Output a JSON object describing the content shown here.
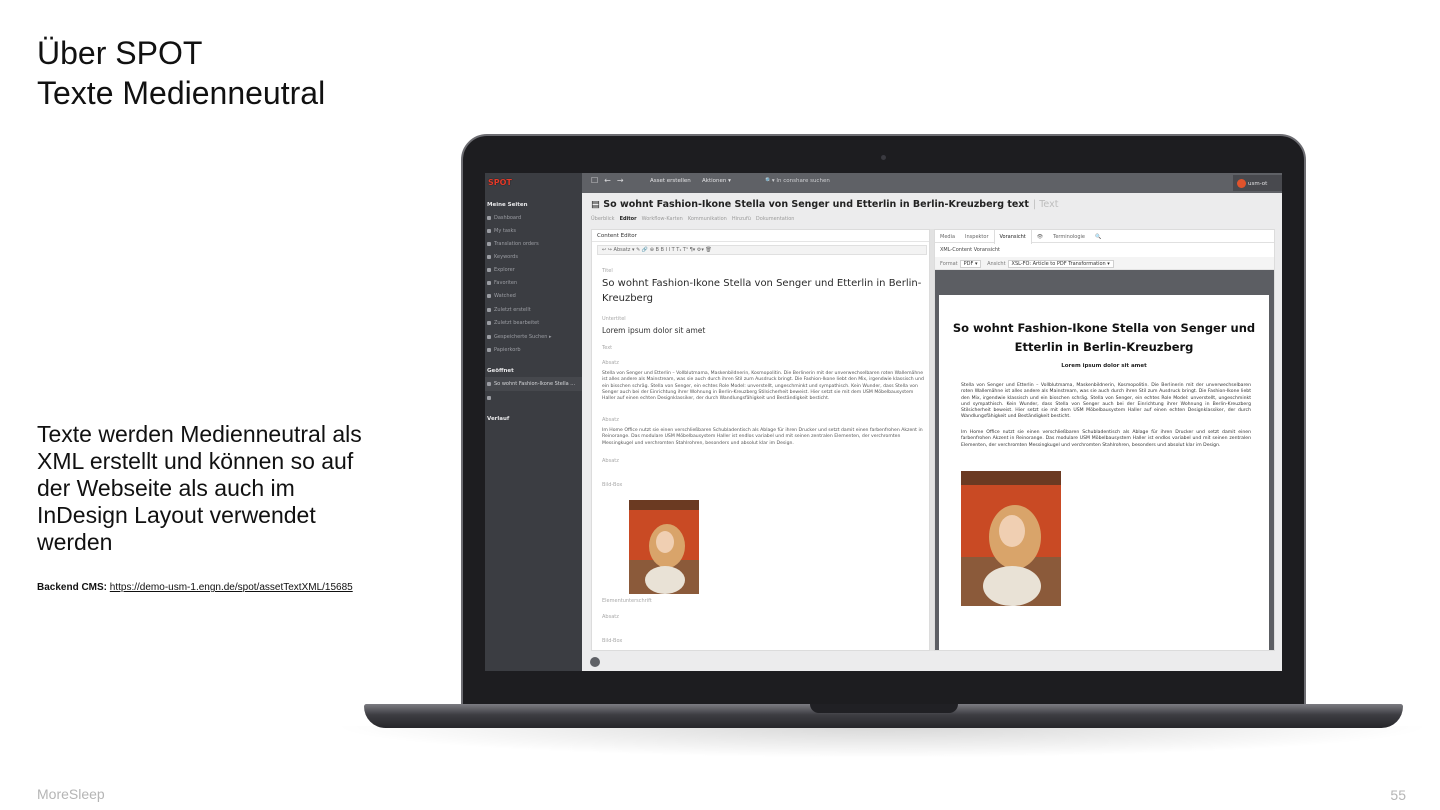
{
  "slide": {
    "title_line1": "Über SPOT",
    "title_line2": "Texte Medienneutral",
    "body": "Texte werden Medienneutral als XML erstellt und können so auf der Webseite als auch im InDesign Layout verwendet werden",
    "backend_label": "Backend CMS:",
    "backend_url": "https://demo-usm-1.engn.de/spot/assetTextXML/15685",
    "footer_brand": "MoreSleep",
    "page_number": "55"
  },
  "app": {
    "logo": "SPOT",
    "topbar": {
      "create_asset": "Asset erstellen",
      "actions": "Aktionen ▾",
      "search_placeholder": "In conshare suchen",
      "user": "usm-ot"
    },
    "sidebar": {
      "my_pages": "Meine Seiten",
      "items": [
        "Dashboard",
        "My tasks",
        "Translation orders",
        "Keywords",
        "Explorer",
        "Favoriten",
        "Watched",
        "Zuletzt erstellt",
        "Zuletzt bearbeitet",
        "Gespeicherte Suchen ▸",
        "Papierkorb"
      ],
      "opened_header": "Geöffnet",
      "opened_item": "So wohnt Fashion-Ikone Stella ...",
      "history_header": "Verlauf"
    },
    "document": {
      "title": "So wohnt Fashion-Ikone Stella von Senger und Etterlin in Berlin-Kreuzberg text",
      "type_suffix": "| Text",
      "subtabs": [
        "Überblick",
        "Editor",
        "Workflow-Karten",
        "Kommunikation",
        "Hinzufü",
        "Dokumentation"
      ]
    },
    "editor": {
      "header": "Content Editor",
      "toolbar": "↩ ↪  Absatz ▾   ✎ 🔗 ⊕   B  B  I  I  T  T₁ T¹  ¶▾  ⚙▾  🗑",
      "label_titel": "Titel",
      "titel": "So wohnt Fashion-Ikone Stella von Senger und Etterlin in Berlin-Kreuzberg",
      "label_untertitel": "Untertitel",
      "untertitel": "Lorem ipsum dolor sit amet",
      "label_text": "Text",
      "label_absatz": "Absatz",
      "absatz1": "Stella von Senger und Etterlin – Vollblutmama, Maskenbildnerin, Kosmopolitin. Die Berlinerin mit der unverwechselbaren roten Wallemähne ist alles andere als Mainstream, was sie auch durch ihren Stil zum Ausdruck bringt. Die Fashion-Ikone liebt den Mix, irgendwie klassisch und ein bisschen schräg. Stella von Senger, ein echtes Role Model: unverstellt, ungeschminkt und sympathisch. Kein Wunder, dass Stella von Senger auch bei der Einrichtung ihrer Wohnung in Berlin-Kreuzberg Stilsicherheit beweist. Hier setzt sie mit dem USM Möbelbausystem Haller auf einen echten Designklassiker, der durch Wandlungsfähigkeit und Beständigkeit besticht.",
      "absatz2": "Im Home Office nutzt sie einen verschließbaren Schubladentisch als Ablage für ihren Drucker und setzt damit einen farbenfrohen Akzent in Reinorange. Das modulare USM Möbelbausystem Haller ist endlos variabel und mit seinen zentralen Elementen, der verchromten Messingkugel und verchromten Stahlrohren, besonders und absolut klar im Design.",
      "label_absatz3": "Absatz",
      "label_bildbox": "Bild-Box",
      "label_unterschrift": "Elementunterschrift",
      "label_absatz4": "Absatz",
      "label_bildbox2": "Bild-Box"
    },
    "preview": {
      "tabs": [
        "Media",
        "Inspektor",
        "Voransicht",
        "👁",
        "Terminologie",
        "🔍"
      ],
      "sub": "XML-Content Voransicht",
      "format_label": "Format",
      "format_value": "PDF ▾",
      "view_label": "Ansicht",
      "view_value": "XSL-FO: Article to PDF Transformation ▾",
      "title": "So wohnt Fashion-Ikone Stella von Senger und Etterlin in Berlin-Kreuzberg",
      "subtitle": "Lorem ipsum dolor sit amet",
      "p1": "Stella von Senger und Etterlin – Vollblutmama, Maskenbildnerin, Kosmopolitin. Die Berlinerin mit der unverwechselbaren roten Wallemähne ist alles andere als Mainstream, was sie auch durch ihren Stil zum Ausdruck bringt. Die Fashion-Ikone liebt den Mix, irgendwie klassisch und ein bisschen schräg. Stella von Senger, ein echtes Role Model: unverstellt, ungeschminkt und sympathisch. Kein Wunder, dass Stella von Senger auch bei der Einrichtung ihrer Wohnung in Berlin-Kreuzberg Stilsicherheit beweist. Hier setzt sie mit dem USM Möbelbausystem Haller auf einen echten Designklassiker, der durch Wandlungsfähigkeit und Beständigkeit besticht.",
      "p2": "Im Home Office nutzt sie einen verschließbaren Schubladentisch als Ablage für ihren Drucker und setzt damit einen farbenfrohen Akzent in Reinorange. Das modulare USM Möbelbausystem Haller ist endlos variabel und mit seinen zentralen Elementen, der verchromten Messingkugel und verchromten Stahlrohren, besonders und absolut klar im Design."
    }
  }
}
